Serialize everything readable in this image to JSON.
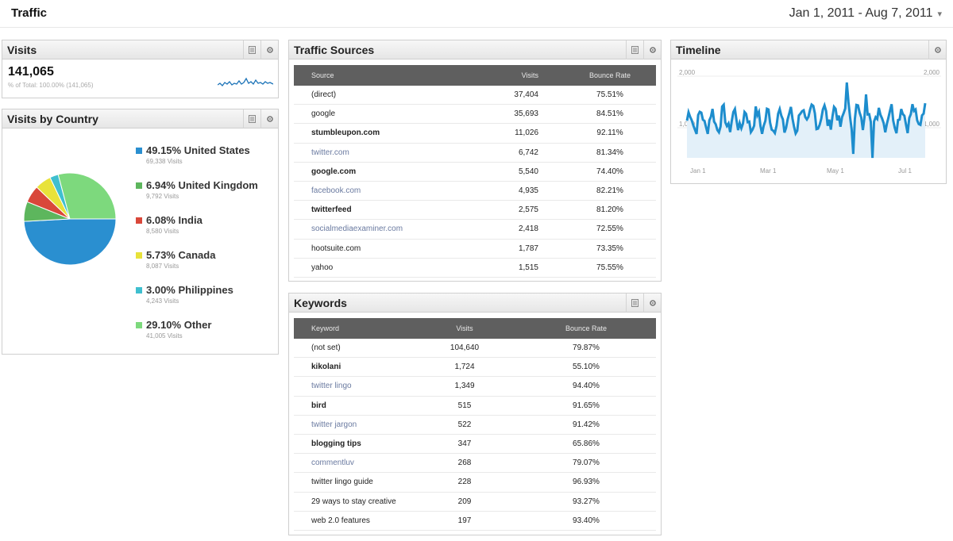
{
  "header": {
    "title": "Traffic",
    "date_range": "Jan 1, 2011 - Aug 7, 2011",
    "chevron": "▾"
  },
  "visits": {
    "title": "Visits",
    "total": "141,065",
    "subtext": "% of Total: 100.00% (141,065)",
    "sparkline_icon": "sparkline"
  },
  "country": {
    "title": "Visits by Country",
    "items": [
      {
        "label": "49.15% United States",
        "sub": "69,338 Visits",
        "color": "#2a8fd0"
      },
      {
        "label": "6.94% United Kingdom",
        "sub": "9,792 Visits",
        "color": "#5db65d"
      },
      {
        "label": "6.08% India",
        "sub": "8,580 Visits",
        "color": "#d9473a"
      },
      {
        "label": "5.73% Canada",
        "sub": "8,087 Visits",
        "color": "#e8e23a"
      },
      {
        "label": "3.00% Philippines",
        "sub": "4,243 Visits",
        "color": "#3fbfcf"
      },
      {
        "label": "29.10% Other",
        "sub": "41,005 Visits",
        "color": "#7dd97d"
      }
    ]
  },
  "sources": {
    "title": "Traffic Sources",
    "columns": [
      "Source",
      "Visits",
      "Bounce Rate"
    ],
    "rows": [
      [
        "(direct)",
        "37,404",
        "75.51%"
      ],
      [
        "google",
        "35,693",
        "84.51%"
      ],
      [
        "stumbleupon.com",
        "11,026",
        "92.11%"
      ],
      [
        "twitter.com",
        "6,742",
        "81.34%"
      ],
      [
        "google.com",
        "5,540",
        "74.40%"
      ],
      [
        "facebook.com",
        "4,935",
        "82.21%"
      ],
      [
        "twitterfeed",
        "2,575",
        "81.20%"
      ],
      [
        "socialmediaexaminer.com",
        "2,418",
        "72.55%"
      ],
      [
        "hootsuite.com",
        "1,787",
        "73.35%"
      ],
      [
        "yahoo",
        "1,515",
        "75.55%"
      ]
    ]
  },
  "keywords": {
    "title": "Keywords",
    "columns": [
      "Keyword",
      "Visits",
      "Bounce Rate"
    ],
    "rows": [
      [
        "(not set)",
        "104,640",
        "79.87%"
      ],
      [
        "kikolani",
        "1,724",
        "55.10%"
      ],
      [
        "twitter lingo",
        "1,349",
        "94.40%"
      ],
      [
        "bird",
        "515",
        "91.65%"
      ],
      [
        "twitter jargon",
        "522",
        "91.42%"
      ],
      [
        "blogging tips",
        "347",
        "65.86%"
      ],
      [
        "commentluv",
        "268",
        "79.07%"
      ],
      [
        "twitter lingo guide",
        "228",
        "96.93%"
      ],
      [
        "29 ways to stay creative",
        "209",
        "93.27%"
      ],
      [
        "web 2.0 features",
        "197",
        "93.40%"
      ]
    ]
  },
  "timeline": {
    "title": "Timeline",
    "y_labels": [
      "2,000",
      "1,000"
    ],
    "y_labels_right": [
      "2,000",
      "1,000"
    ],
    "x_labels": [
      "Jan 1",
      "Mar 1",
      "May 1",
      "Jul 1"
    ],
    "line_color": "#1d8dcd"
  }
}
